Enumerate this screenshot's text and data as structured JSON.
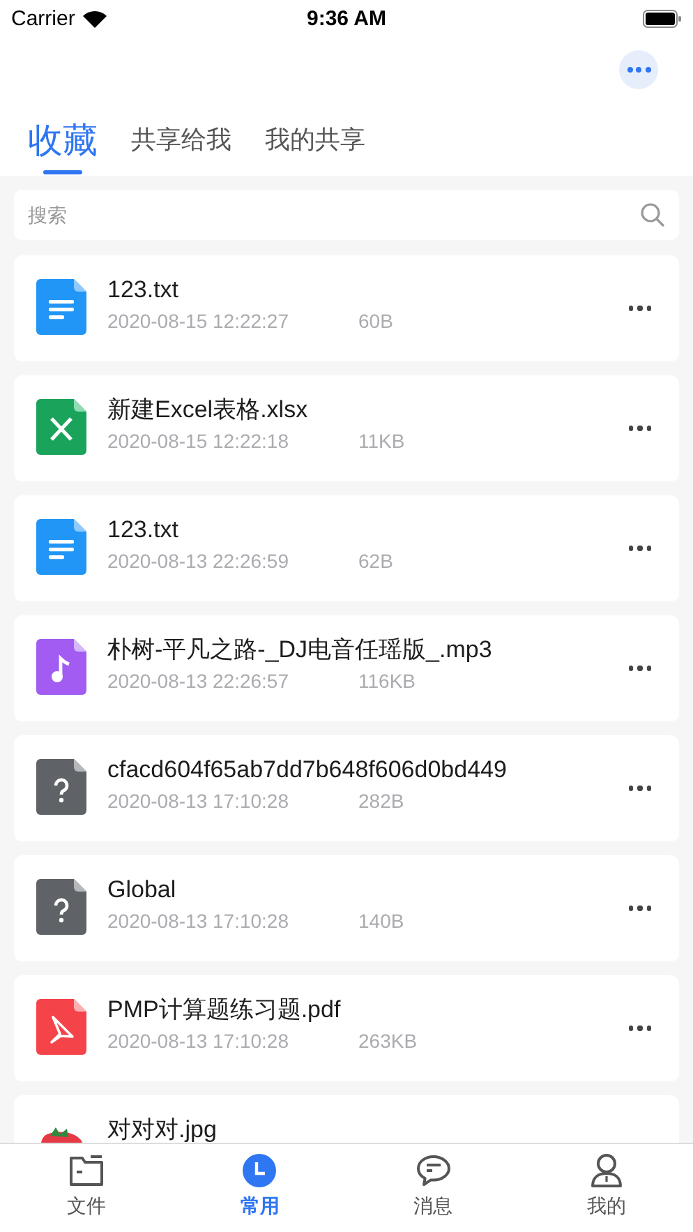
{
  "status_bar": {
    "carrier": "Carrier",
    "time": "9:36 AM"
  },
  "tabs": [
    {
      "label": "收藏",
      "selected": true
    },
    {
      "label": "共享给我",
      "selected": false
    },
    {
      "label": "我的共享",
      "selected": false
    }
  ],
  "search": {
    "placeholder": "搜索"
  },
  "files": [
    {
      "kind": "text",
      "name": "123.txt",
      "date": "2020-08-15 12:22:27",
      "size": "60B"
    },
    {
      "kind": "excel",
      "name": "新建Excel表格.xlsx",
      "date": "2020-08-15 12:22:18",
      "size": "11KB"
    },
    {
      "kind": "text",
      "name": "123.txt",
      "date": "2020-08-13 22:26:59",
      "size": "62B"
    },
    {
      "kind": "audio",
      "name": "朴树-平凡之路-_DJ电音任瑶版_.mp3",
      "date": "2020-08-13 22:26:57",
      "size": "116KB"
    },
    {
      "kind": "unknown",
      "name": "cfacd604f65ab7dd7b648f606d0bd449",
      "date": "2020-08-13 17:10:28",
      "size": "282B"
    },
    {
      "kind": "unknown",
      "name": "Global",
      "date": "2020-08-13 17:10:28",
      "size": "140B"
    },
    {
      "kind": "pdf",
      "name": "PMP计算题练习题.pdf",
      "date": "2020-08-13 17:10:28",
      "size": "263KB"
    },
    {
      "name": "对对对.jpg"
    }
  ],
  "bottom_nav": [
    {
      "kind": "folder",
      "label": "文件",
      "selected": false
    },
    {
      "kind": "clock",
      "label": "常用",
      "selected": true
    },
    {
      "kind": "chat",
      "label": "消息",
      "selected": false
    },
    {
      "kind": "person",
      "label": "我的",
      "selected": false
    }
  ]
}
